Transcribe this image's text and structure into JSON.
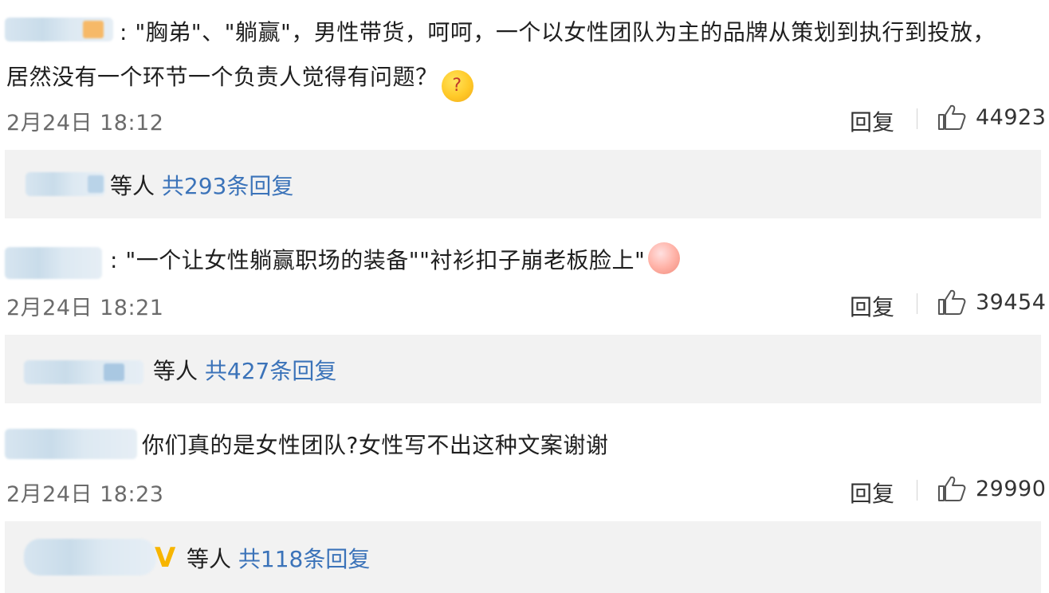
{
  "comments": [
    {
      "text_line1": ": \"胸弟\"、\"躺赢\"，男性带货，呵呵，一个以女性团队为主的品牌从策划到执行到投放，",
      "text_line2": "居然没有一个环节一个负责人觉得有问题？",
      "emoji": "confused-face-emoji",
      "date": "2月24日  18:12",
      "reply_label": "回复",
      "likes": "44923",
      "replies_who": "等人",
      "replies_count": "共293条回复"
    },
    {
      "text_line1": ": \"一个让女性躺赢职场的装备\"\"衬衫扣子崩老板脸上\"",
      "emoji": "grimacing-face-emoji",
      "date": "2月24日  18:21",
      "reply_label": "回复",
      "likes": "39454",
      "replies_who": "等人",
      "replies_count": "共427条回复"
    },
    {
      "text_line1": "你们真的是女性团队?女性写不出这种文案谢谢",
      "date": "2月24日  18:23",
      "reply_label": "回复",
      "likes": "29990",
      "replies_who": "等人",
      "replies_count": "共118条回复",
      "verified_badge": "V"
    }
  ],
  "colors": {
    "link_blue": "#3b73b9",
    "reply_bg": "#f2f2f2",
    "meta_gray": "#6b6b6b",
    "badge_gold": "#f7b500"
  },
  "icons": {
    "like": "thumbs-up-icon"
  }
}
